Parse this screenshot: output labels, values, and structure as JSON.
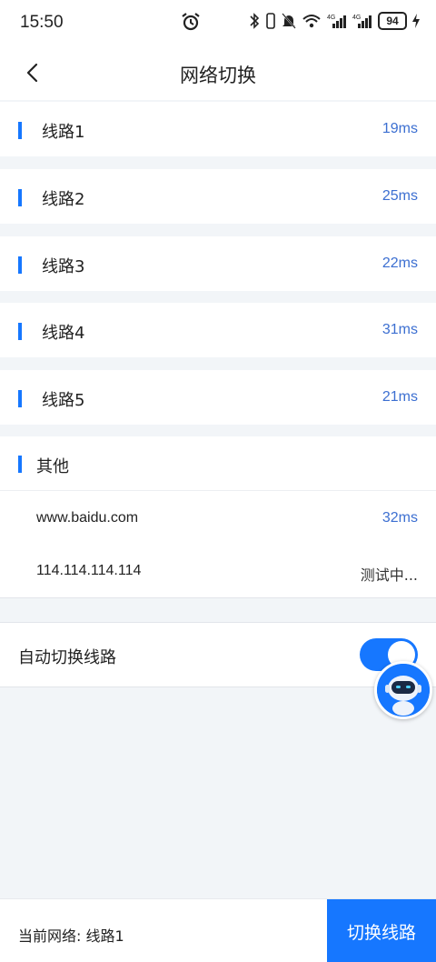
{
  "status_bar": {
    "time": "15:50",
    "battery": "94",
    "icons": [
      "alarm-icon",
      "bluetooth-icon",
      "vibrate-icon",
      "mute-icon",
      "wifi-icon",
      "signal-4g-icon",
      "signal-4g-icon",
      "battery-icon",
      "charging-icon"
    ]
  },
  "header": {
    "title": "网络切换",
    "back_icon": "chevron-left-icon"
  },
  "routes": [
    {
      "name": "线路1",
      "latency": "19ms"
    },
    {
      "name": "线路2",
      "latency": "25ms"
    },
    {
      "name": "线路3",
      "latency": "22ms"
    },
    {
      "name": "线路4",
      "latency": "31ms"
    },
    {
      "name": "线路5",
      "latency": "21ms"
    }
  ],
  "other": {
    "title": "其他",
    "hosts": [
      {
        "host": "www.baidu.com",
        "latency": "32ms"
      },
      {
        "host": "114.114.114.114",
        "latency": "测试中..."
      }
    ]
  },
  "auto_switch": {
    "label": "自动切换线路",
    "enabled": true
  },
  "footer": {
    "current_network": "当前网络: 线路1",
    "switch_button": "切换线路"
  },
  "colors": {
    "accent": "#1677ff",
    "latency_text": "#3c6fd1",
    "background": "#f2f5f8"
  }
}
